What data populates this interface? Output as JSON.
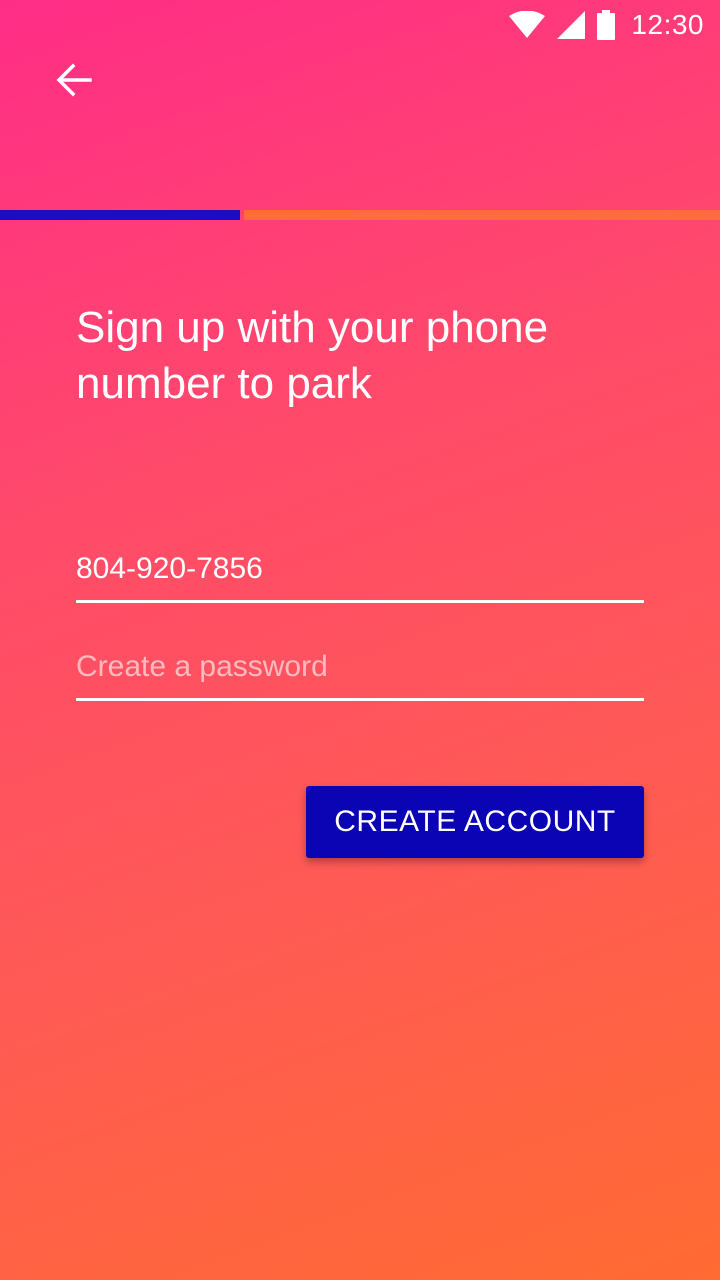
{
  "status_bar": {
    "time": "12:30",
    "icons": [
      "wifi-icon",
      "cell-signal-icon",
      "battery-icon"
    ]
  },
  "app_bar": {
    "back_icon": "arrow-left-icon"
  },
  "progress": {
    "fraction": 0.333,
    "colors": {
      "fill": "#1a0fbf",
      "track": "#ff6e3a"
    }
  },
  "signup": {
    "heading": "Sign up with your phone number to park",
    "phone_value": "804-920-7856",
    "password_placeholder": "Create a password",
    "create_button_label": "CREATE ACCOUNT"
  },
  "colors": {
    "gradient_start": "#ff2d87",
    "gradient_end": "#ff6b32",
    "button": "#0a04b4"
  }
}
